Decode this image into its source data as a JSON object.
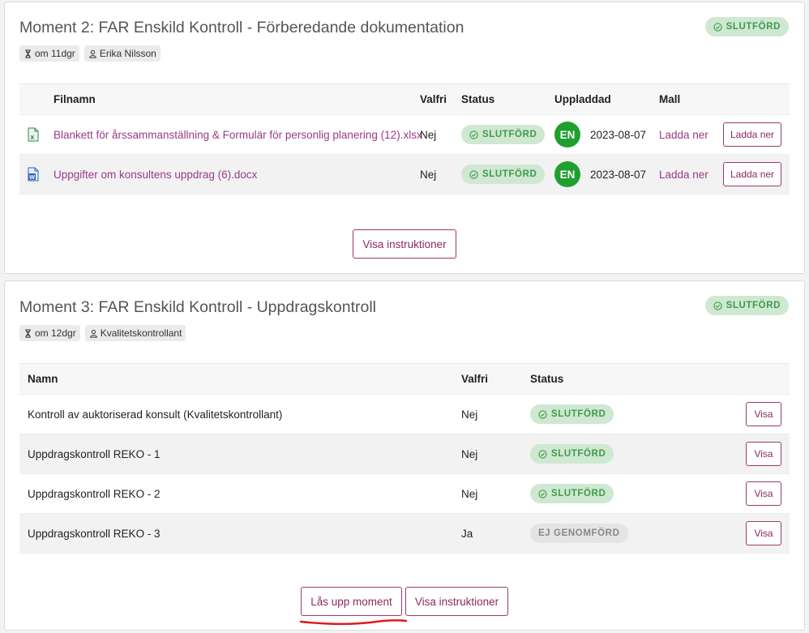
{
  "moment2": {
    "title": "Moment 2: FAR Enskild Kontroll - Förberedande dokumentation",
    "status": "SLUTFÖRD",
    "deadline": "om 11dgr",
    "assignee": "Erika Nilsson",
    "columns": {
      "filename": "Filnamn",
      "optional": "Valfri",
      "status": "Status",
      "uploaded": "Uppladdad",
      "template": "Mall"
    },
    "files": [
      {
        "file_type_icon": "excel-file-icon",
        "name": "Blankett för årssammanställning & Formulär för personlig planering (12).xlsx",
        "optional": "Nej",
        "status": "SLUTFÖRD",
        "uploader_initials": "EN",
        "date": "2023-08-07",
        "template_link": "Ladda ner",
        "download_button": "Ladda ner"
      },
      {
        "file_type_icon": "word-file-icon",
        "name": "Uppgifter om konsultens uppdrag (6).docx",
        "optional": "Nej",
        "status": "SLUTFÖRD",
        "uploader_initials": "EN",
        "date": "2023-08-07",
        "template_link": "Ladda ner",
        "download_button": "Ladda ner"
      }
    ],
    "instructions_button": "Visa instruktioner"
  },
  "moment3": {
    "title": "Moment 3: FAR Enskild Kontroll - Uppdragskontroll",
    "status": "SLUTFÖRD",
    "deadline": "om 12dgr",
    "assignee": "Kvalitetskontrollant",
    "columns": {
      "name": "Namn",
      "optional": "Valfri",
      "status": "Status"
    },
    "rows": [
      {
        "name": "Kontroll av auktoriserad konsult (Kvalitetskontrollant)",
        "optional": "Nej",
        "status": "SLUTFÖRD",
        "action": "Visa"
      },
      {
        "name": "Uppdragskontroll REKO - 1",
        "optional": "Nej",
        "status": "SLUTFÖRD",
        "action": "Visa"
      },
      {
        "name": "Uppdragskontroll REKO - 2",
        "optional": "Nej",
        "status": "SLUTFÖRD",
        "action": "Visa"
      },
      {
        "name": "Uppdragskontroll REKO - 3",
        "optional": "Ja",
        "status": "EJ GENOMFÖRD",
        "action": "Visa"
      }
    ],
    "unlock_button": "Lås upp moment",
    "instructions_button": "Visa instruktioner"
  },
  "colors": {
    "accent": "#9a3a6e",
    "link": "#9a3a87",
    "done_badge_bg": "#cfe8d2",
    "done_badge_text": "#3f9a4c",
    "notdone_badge_bg": "#e4e4e4",
    "avatar_bg": "#1f9f2f",
    "annotation_red": "#e0191d"
  }
}
